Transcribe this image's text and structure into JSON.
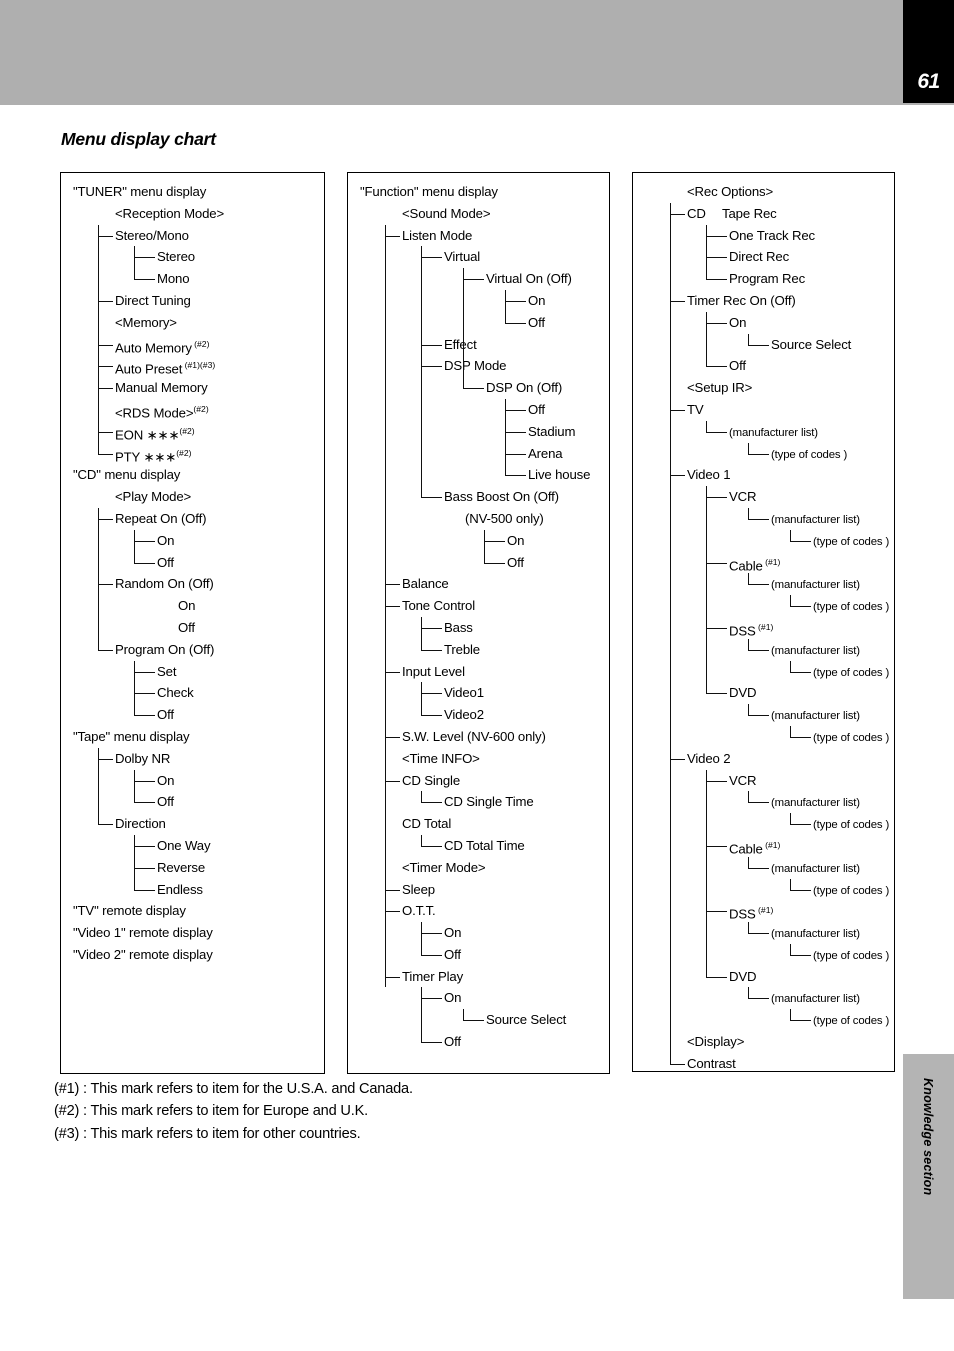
{
  "page": {
    "number": "61",
    "side_tab": "Knowledge section"
  },
  "title": "Menu display chart",
  "columns": [
    {
      "id": "tuner",
      "rows": [
        {
          "t": "\"TUNER\" menu display",
          "i": 0
        },
        {
          "t": "<Reception Mode>",
          "i": 2
        },
        {
          "t": "Stereo/Mono",
          "i": 2,
          "k": "t1"
        },
        {
          "t": "Stereo",
          "i": 4,
          "k": "t2"
        },
        {
          "t": "Mono",
          "i": 4,
          "k": "e2"
        },
        {
          "t": "Direct Tuning",
          "i": 2,
          "k": "t1"
        },
        {
          "t": "<Memory>",
          "i": 2
        },
        {
          "t": "Auto Memory",
          "s": " (#2)",
          "i": 2,
          "k": "t1"
        },
        {
          "t": "Auto Preset",
          "s": " (#1)(#3)",
          "i": 2,
          "k": "t1"
        },
        {
          "t": "Manual Memory",
          "i": 2,
          "k": "t1"
        },
        {
          "t": "<RDS Mode>",
          "s": "(#2)",
          "i": 2
        },
        {
          "t": "EON ∗∗∗",
          "s": "(#2)",
          "i": 2,
          "k": "t1"
        },
        {
          "t": "PTY ∗∗∗",
          "s": "(#2)",
          "i": 2,
          "k": "e1"
        },
        {
          "t": "\"CD\" menu display",
          "i": 0
        },
        {
          "t": "<Play Mode>",
          "i": 2
        },
        {
          "t": "Repeat On (Off)",
          "i": 2,
          "k": "t1"
        },
        {
          "t": "On",
          "i": 4,
          "k": "t2"
        },
        {
          "t": "Off",
          "i": 4,
          "k": "e2"
        },
        {
          "t": "Random On (Off)",
          "i": 2,
          "k": "t1"
        },
        {
          "t": "On",
          "i": 5
        },
        {
          "t": "Off",
          "i": 5
        },
        {
          "t": "Program On (Off)",
          "i": 2,
          "k": "e1"
        },
        {
          "t": "Set",
          "i": 4,
          "k": "t2"
        },
        {
          "t": "Check",
          "i": 4,
          "k": "t2"
        },
        {
          "t": "Off",
          "i": 4,
          "k": "e2"
        },
        {
          "t": "\"Tape\" menu display",
          "i": 0
        },
        {
          "t": "Dolby NR",
          "i": 2,
          "k": "t1"
        },
        {
          "t": "On",
          "i": 4,
          "k": "t2"
        },
        {
          "t": "Off",
          "i": 4,
          "k": "e2"
        },
        {
          "t": "Direction",
          "i": 2,
          "k": "e1"
        },
        {
          "t": "One Way",
          "i": 4,
          "k": "t2"
        },
        {
          "t": "Reverse",
          "i": 4,
          "k": "t2"
        },
        {
          "t": "Endless",
          "i": 4,
          "k": "e2"
        },
        {
          "t": "\"TV\" remote display",
          "i": 0
        },
        {
          "t": "\"Video 1\" remote display",
          "i": 0
        },
        {
          "t": "\"Video 2\" remote display",
          "i": 0
        }
      ]
    },
    {
      "id": "function",
      "rows": [
        {
          "t": "\"Function\" menu display",
          "i": 0
        },
        {
          "t": "<Sound Mode>",
          "i": 2
        },
        {
          "t": "Listen Mode",
          "i": 2,
          "k": "t1"
        },
        {
          "t": "Virtual",
          "i": 4,
          "k": "t2"
        },
        {
          "t": "Virtual On (Off)",
          "i": 6,
          "k": "t3"
        },
        {
          "t": "On",
          "i": 8,
          "k": "t4"
        },
        {
          "t": "Off",
          "i": 8,
          "k": "e4"
        },
        {
          "t": "Effect",
          "i": 4,
          "k": "e2b"
        },
        {
          "t": "DSP Mode",
          "i": 4,
          "k": "t2"
        },
        {
          "t": "DSP On (Off)",
          "i": 6,
          "k": "e3"
        },
        {
          "t": "Off",
          "i": 8,
          "k": "t4"
        },
        {
          "t": "Stadium",
          "i": 8,
          "k": "t4"
        },
        {
          "t": "Arena",
          "i": 8,
          "k": "t4"
        },
        {
          "t": "Live house",
          "i": 8,
          "k": "e4"
        },
        {
          "t": "Bass Boost On (Off)",
          "i": 4,
          "k": "e2"
        },
        {
          "t": "(NV-500 only)",
          "i": 5
        },
        {
          "t": "On",
          "i": 7,
          "k": "t4b"
        },
        {
          "t": "Off",
          "i": 7,
          "k": "e4b"
        },
        {
          "t": "Balance",
          "i": 2,
          "k": "t1"
        },
        {
          "t": "Tone Control",
          "i": 2,
          "k": "t1"
        },
        {
          "t": "Bass",
          "i": 4,
          "k": "t2"
        },
        {
          "t": "Treble",
          "i": 4,
          "k": "e2"
        },
        {
          "t": "Input Level",
          "i": 2,
          "k": "t1"
        },
        {
          "t": "Video1",
          "i": 4,
          "k": "t2"
        },
        {
          "t": "Video2",
          "i": 4,
          "k": "e2"
        },
        {
          "t": "S.W. Level (NV-600 only)",
          "i": 2,
          "k": "t1"
        },
        {
          "t": "<Time INFO>",
          "i": 2
        },
        {
          "t": "CD Single",
          "i": 2,
          "k": "t1"
        },
        {
          "t": "CD Single Time",
          "i": 4,
          "k": "e2"
        },
        {
          "t": "CD Total",
          "i": 2
        },
        {
          "t": "CD Total Time",
          "i": 4,
          "k": "e2"
        },
        {
          "t": "<Timer Mode>",
          "i": 2
        },
        {
          "t": "Sleep",
          "i": 2,
          "k": "t1"
        },
        {
          "t": "O.T.T.",
          "i": 2,
          "k": "t1"
        },
        {
          "t": "On",
          "i": 4,
          "k": "t2"
        },
        {
          "t": "Off",
          "i": 4,
          "k": "e2"
        },
        {
          "t": "Timer Play",
          "i": 2,
          "k": "t1"
        },
        {
          "t": "On",
          "i": 4,
          "k": "t2"
        },
        {
          "t": "Source Select",
          "i": 6,
          "k": "e3"
        },
        {
          "t": "Off",
          "i": 4,
          "k": "e2"
        }
      ]
    },
    {
      "id": "rec",
      "rows": [
        {
          "t": "<Rec Options>",
          "i": 2
        },
        {
          "t": "CD  Tape Rec",
          "i": 2,
          "k": "t1"
        },
        {
          "t": "One Track Rec",
          "i": 4,
          "k": "t2"
        },
        {
          "t": "Direct Rec",
          "i": 4,
          "k": "t2"
        },
        {
          "t": "Program Rec",
          "i": 4,
          "k": "e2"
        },
        {
          "t": "Timer Rec On (Off)",
          "i": 2,
          "k": "t1"
        },
        {
          "t": "On",
          "i": 4,
          "k": "t2"
        },
        {
          "t": "Source Select",
          "i": 6,
          "k": "e3"
        },
        {
          "t": "Off",
          "i": 4,
          "k": "e2"
        },
        {
          "t": "<Setup IR>",
          "i": 2
        },
        {
          "t": "TV",
          "i": 2,
          "k": "t1"
        },
        {
          "t": "(manufacturer list)",
          "i": 4,
          "k": "e2",
          "sm": true
        },
        {
          "t": "(type of codes )",
          "i": 6,
          "k": "e3",
          "sm": true
        },
        {
          "t": "Video 1",
          "i": 2,
          "k": "t1"
        },
        {
          "t": "VCR",
          "i": 4,
          "k": "t2"
        },
        {
          "t": "(manufacturer list)",
          "i": 6,
          "k": "e3",
          "sm": true
        },
        {
          "t": "(type of codes )",
          "i": 8,
          "k": "e4",
          "sm": true
        },
        {
          "t": "Cable",
          "s": " (#1)",
          "i": 4,
          "k": "t2"
        },
        {
          "t": "(manufacturer list)",
          "i": 6,
          "k": "e3",
          "sm": true
        },
        {
          "t": "(type of codes )",
          "i": 8,
          "k": "e4",
          "sm": true
        },
        {
          "t": "DSS",
          "s": " (#1)",
          "i": 4,
          "k": "t2"
        },
        {
          "t": "(manufacturer list)",
          "i": 6,
          "k": "e3",
          "sm": true
        },
        {
          "t": "(type of codes )",
          "i": 8,
          "k": "e4",
          "sm": true
        },
        {
          "t": "DVD",
          "i": 4,
          "k": "e2"
        },
        {
          "t": "(manufacturer list)",
          "i": 6,
          "k": "e3",
          "sm": true
        },
        {
          "t": "(type of codes )",
          "i": 8,
          "k": "e4",
          "sm": true
        },
        {
          "t": "Video 2",
          "i": 2,
          "k": "t1"
        },
        {
          "t": "VCR",
          "i": 4,
          "k": "t2"
        },
        {
          "t": "(manufacturer list)",
          "i": 6,
          "k": "e3",
          "sm": true
        },
        {
          "t": "(type of codes )",
          "i": 8,
          "k": "e4",
          "sm": true
        },
        {
          "t": "Cable",
          "s": " (#1)",
          "i": 4,
          "k": "t2"
        },
        {
          "t": "(manufacturer list)",
          "i": 6,
          "k": "e3",
          "sm": true
        },
        {
          "t": "(type of codes )",
          "i": 8,
          "k": "e4",
          "sm": true
        },
        {
          "t": "DSS",
          "s": " (#1)",
          "i": 4,
          "k": "t2"
        },
        {
          "t": "(manufacturer list)",
          "i": 6,
          "k": "e3",
          "sm": true
        },
        {
          "t": "(type of codes )",
          "i": 8,
          "k": "e4",
          "sm": true
        },
        {
          "t": "DVD",
          "i": 4,
          "k": "e2"
        },
        {
          "t": "(manufacturer list)",
          "i": 6,
          "k": "e3",
          "sm": true
        },
        {
          "t": "(type of codes )",
          "i": 8,
          "k": "e4",
          "sm": true
        },
        {
          "t": "<Display>",
          "i": 2
        },
        {
          "t": "Contrast",
          "i": 2,
          "k": "e1"
        }
      ]
    }
  ],
  "footnotes": [
    "(#1) : This mark refers to item for the U.S.A. and Canada.",
    "(#2) : This mark refers to item for Europe and U.K.",
    "(#3) : This mark refers to item for other countries."
  ]
}
